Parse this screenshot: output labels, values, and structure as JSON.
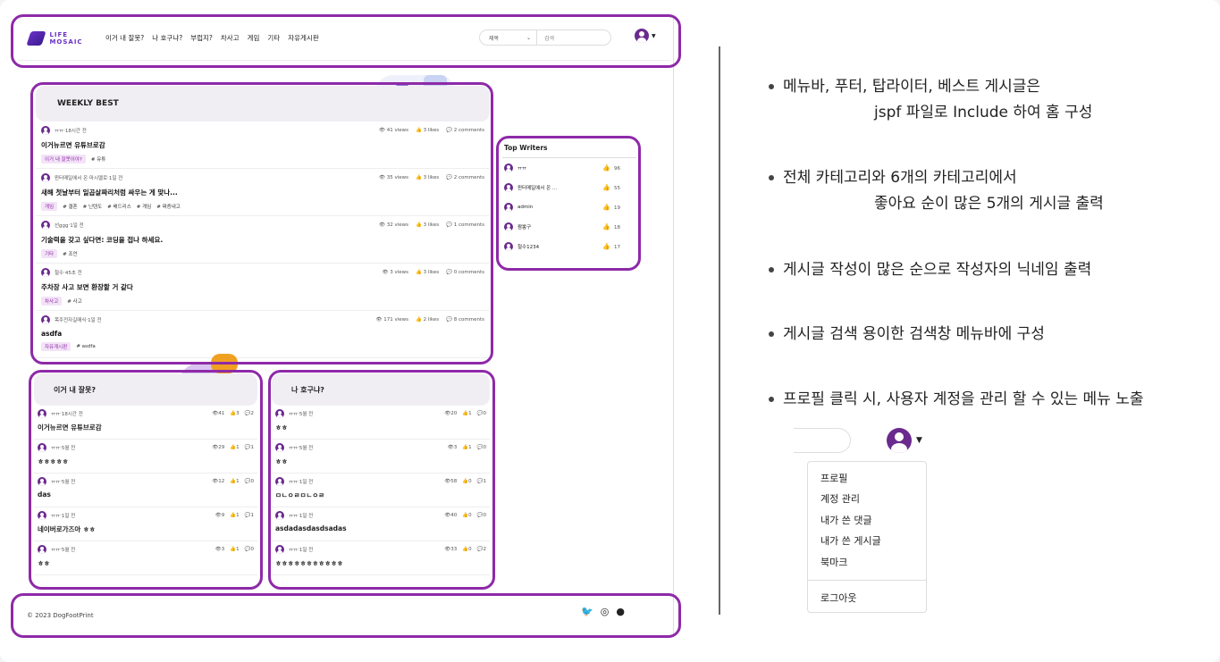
{
  "navbar": {
    "logo_text": "LIFE MOSAIC",
    "menu": [
      "이거 내 잘못?",
      "나 호구냐?",
      "부럽지?",
      "차사고",
      "게임",
      "기타",
      "자유게시판"
    ],
    "search_select": "제목",
    "search_placeholder": "검색"
  },
  "weekly_best": {
    "title": "WEEKLY BEST",
    "posts": [
      {
        "author": "ㅠㅠ",
        "time": "18시간 전",
        "views": "41 views",
        "likes": "3 likes",
        "comments": "2 comments",
        "title": "이거뉴르면 유튜브로감",
        "category": "이거 내 잘못이야?",
        "tags": [
          "# 유튜"
        ]
      },
      {
        "author": "윈터메일에서 온 마시멜로",
        "time": "1일 전",
        "views": "35 views",
        "likes": "3 likes",
        "comments": "2 comments",
        "title": "새해 첫날부터 일곱살짜리처럼 싸우는 게 맞나...",
        "category": "게임",
        "tags": [
          "# 결혼",
          "# 닌텐도",
          "# 배드리스",
          "# 게임",
          "# 짜증내고"
        ]
      },
      {
        "author": "선ggg",
        "time": "1일 전",
        "views": "32 views",
        "likes": "3 likes",
        "comments": "1 comments",
        "title": "기술력을 갖고 싶다면: 코딩을 접나 하세요.",
        "category": "기타",
        "tags": [
          "# 조언"
        ]
      },
      {
        "author": "철수",
        "time": "45초 전",
        "views": "3 views",
        "likes": "3 likes",
        "comments": "0 comments",
        "title": "주차장 사고 보면 환장할 거 같다",
        "category": "차사고",
        "tags": [
          "# 사고"
        ]
      },
      {
        "author": "목주전자길매식",
        "time": "1일 전",
        "views": "171 views",
        "likes": "2 likes",
        "comments": "8 comments",
        "title": "asdfa",
        "category": "자유게시판",
        "tags": [
          "# asdfa"
        ]
      }
    ]
  },
  "top_writers": {
    "title": "Top Writers",
    "rows": [
      {
        "name": "ㅠㅠ",
        "count": "96"
      },
      {
        "name": "윈터메일에서 온 ...",
        "count": "55"
      },
      {
        "name": "admin",
        "count": "19"
      },
      {
        "name": "짬뽕구",
        "count": "18"
      },
      {
        "name": "철수1234",
        "count": "17"
      }
    ]
  },
  "board_left": {
    "title": "이거 내 잘못?",
    "rows": [
      {
        "author": "ㅠㅠ",
        "time": "18시간 전",
        "views": "41",
        "likes": "3",
        "comments": "2",
        "title": "이거뉴르면 유튜브로감"
      },
      {
        "author": "ㅠㅠ",
        "time": "5월 전",
        "views": "29",
        "likes": "1",
        "comments": "1",
        "title": "ㅎㅎㅎㅎㅎ"
      },
      {
        "author": "ㅠㅠ",
        "time": "5월 전",
        "views": "12",
        "likes": "1",
        "comments": "0",
        "title": "das"
      },
      {
        "author": "ㅠㅠ",
        "time": "1일 전",
        "views": "9",
        "likes": "1",
        "comments": "1",
        "title": "네이버로가즈아 ㅎㅎ"
      },
      {
        "author": "ㅠㅠ",
        "time": "5월 전",
        "views": "3",
        "likes": "1",
        "comments": "0",
        "title": "ㅎㅎ"
      }
    ]
  },
  "board_right": {
    "title": "나 호구냐?",
    "rows": [
      {
        "author": "ㅠㅠ",
        "time": "5월 전",
        "views": "20",
        "likes": "1",
        "comments": "0",
        "title": "ㅎㅎ"
      },
      {
        "author": "ㅠㅠ",
        "time": "5월 전",
        "views": "3",
        "likes": "1",
        "comments": "0",
        "title": "ㅎㅎ"
      },
      {
        "author": "ㅠㅠ",
        "time": "1일 전",
        "views": "58",
        "likes": "0",
        "comments": "1",
        "title": "ㅁㄴㅇㄹㅁㄴㅇㄹ"
      },
      {
        "author": "ㅠㅠ",
        "time": "1일 전",
        "views": "40",
        "likes": "0",
        "comments": "0",
        "title": "asdadasdasdsadas"
      },
      {
        "author": "ㅠㅠ",
        "time": "1일 전",
        "views": "33",
        "likes": "0",
        "comments": "2",
        "title": "ㅎㅎㅎㅎㅎㅎㅎㅎㅎㅎㅎ"
      }
    ]
  },
  "footer": {
    "copyright": "© 2023 DogFootPrint"
  },
  "notes": [
    {
      "line1": "메뉴바, 푸터, 탑라이터, 베스트 게시글은",
      "line2": "jspf 파일로 Include 하여 홈 구성"
    },
    {
      "line1": "전체 카테고리와 6개의 카테고리에서",
      "line2": "좋아요 순이 많은 5개의 게시글 출력"
    },
    {
      "line1": "게시글 작성이 많은 순으로 작성자의 닉네임 출력",
      "line2": ""
    },
    {
      "line1": "게시글 검색 용이한 검색창 메뉴바에 구성",
      "line2": ""
    },
    {
      "line1": "프로필 클릭 시, 사용자 계정을 관리 할 수 있는 메뉴 노출",
      "line2": ""
    }
  ],
  "profile_menu": {
    "items": [
      "프로필",
      "계정 관리",
      "내가 쓴 댓글",
      "내가 쓴 게시글",
      "북마크"
    ],
    "logout": "로그아웃"
  },
  "colors": {
    "highlight": "#8e2aa8",
    "tag_bg": "#f3e3f7"
  }
}
